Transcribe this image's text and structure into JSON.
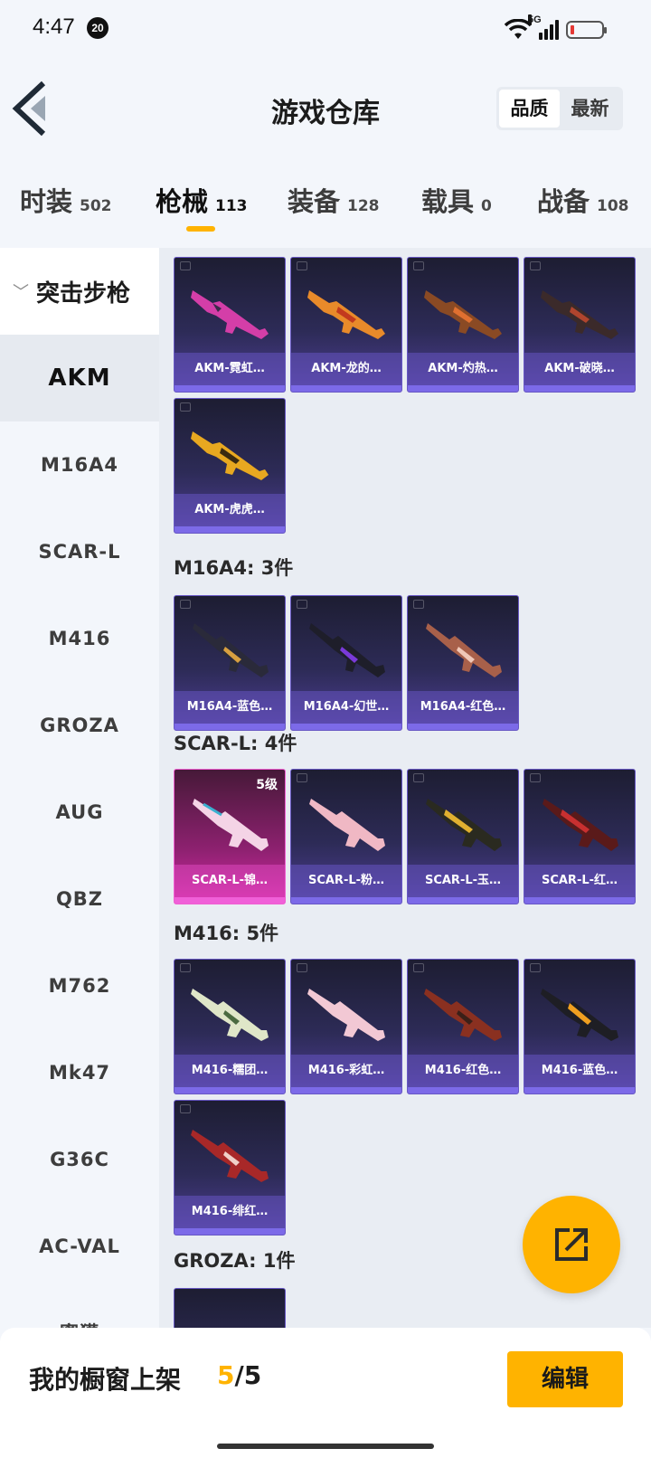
{
  "status_bar": {
    "time": "4:47",
    "badge": "20",
    "network": "5G"
  },
  "header": {
    "title": "游戏仓库",
    "sort_options": [
      "品质",
      "最新"
    ]
  },
  "category_tabs": [
    {
      "label": "时装",
      "count": "502"
    },
    {
      "label": "枪械",
      "count": "113"
    },
    {
      "label": "装备",
      "count": "128"
    },
    {
      "label": "载具",
      "count": "0"
    },
    {
      "label": "战备",
      "count": "108"
    }
  ],
  "sidebar": {
    "group_label": "突击步枪",
    "items": [
      "AKM",
      "M16A4",
      "SCAR-L",
      "M416",
      "GROZA",
      "AUG",
      "QBZ",
      "M762",
      "Mk47",
      "G36C",
      "AC-VAL"
    ],
    "partial_item": "蜜獾"
  },
  "sections": [
    {
      "name": "AKM",
      "items": [
        "AKM-霓虹…",
        "AKM-龙的…",
        "AKM-灼热…",
        "AKM-破晓…",
        "AKM-虎虎…"
      ]
    },
    {
      "header": "M16A4: 3件",
      "items": [
        "M16A4-蓝色…",
        "M16A4-幻世…",
        "M16A4-红色…"
      ]
    },
    {
      "header": "SCAR-L: 4件",
      "items": [
        "SCAR-L-锦…",
        "SCAR-L-粉…",
        "SCAR-L-玉…",
        "SCAR-L-红…"
      ],
      "featured_level": "5级"
    },
    {
      "header": "M416: 5件",
      "items": [
        "M416-糯团…",
        "M416-彩虹…",
        "M416-红色…",
        "M416-蓝色…",
        "M416-绯红…"
      ]
    },
    {
      "header": "GROZA: 1件"
    }
  ],
  "bottom_bar": {
    "label": "我的橱窗上架",
    "count_current": "5",
    "count_total": "/5",
    "edit_label": "编辑"
  },
  "colors": {
    "accent": "#ffb300",
    "card_purple": "#4e3e95",
    "card_pink": "#d32aa8"
  }
}
